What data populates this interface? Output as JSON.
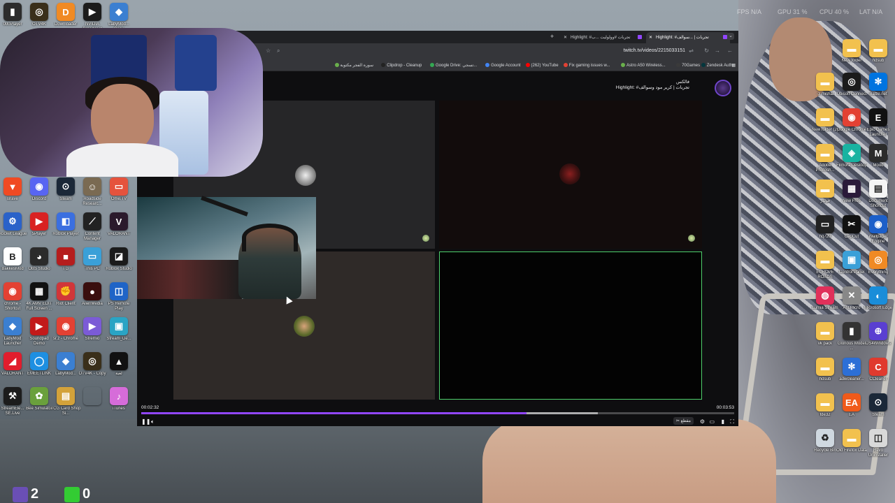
{
  "perf_overlay": {
    "fps": "FPS N/A",
    "gpu": "GPU 31 %",
    "cpu": "CPU 40 %",
    "lat": "LAT N/A"
  },
  "desktop_left": [
    {
      "label": "000Player",
      "icon": "player-icon",
      "color": "#2c2c2c",
      "glyph": "▮"
    },
    {
      "label": "OTV4K",
      "icon": "otv-icon",
      "color": "#3a2f1a",
      "glyph": "◎"
    },
    {
      "label": "Downloader",
      "icon": "downloader-icon",
      "color": "#f08a24",
      "glyph": "D"
    },
    {
      "label": "NVIDIA Broadcast",
      "icon": "nvidia-icon",
      "color": "#1c1c1c",
      "glyph": "▶"
    },
    {
      "label": "LabyMod... Copy",
      "icon": "labymod-icon",
      "color": "#3b7fd1",
      "glyph": "◆"
    },
    {
      "label": "Brave",
      "icon": "brave-icon",
      "color": "#f04a23",
      "glyph": "▼"
    },
    {
      "label": "Discord",
      "icon": "discord-icon",
      "color": "#5865f2",
      "glyph": "◉"
    },
    {
      "label": "Steam",
      "icon": "steam-icon",
      "color": "#1b2838",
      "glyph": "⊙"
    },
    {
      "label": "Roadside Researc...",
      "icon": "roadside-icon",
      "color": "#7a6a52",
      "glyph": "☺"
    },
    {
      "label": "Ome.TV",
      "icon": "ometv-icon",
      "color": "#e5533d",
      "glyph": "▭"
    },
    {
      "label": "Rocket League",
      "icon": "rocket-league-icon",
      "color": "#2a62c9",
      "glyph": "⚙"
    },
    {
      "label": "5Player",
      "icon": "5player-icon",
      "color": "#d92222",
      "glyph": "▶"
    },
    {
      "label": "Roblox Player",
      "icon": "roblox-player-icon",
      "color": "#3b6fe0",
      "glyph": "◧"
    },
    {
      "label": "Content Manager",
      "icon": "content-manager-icon",
      "color": "#222",
      "glyph": "⟋"
    },
    {
      "label": "VALORANT",
      "icon": "valorant-icon",
      "color": "#2b1a2c",
      "glyph": "V"
    },
    {
      "label": "BakkesMod",
      "icon": "bakkesmod-icon",
      "color": "#fff",
      "glyph": "B"
    },
    {
      "label": "OBS Studio",
      "icon": "obs-icon",
      "color": "#2b2b2b",
      "glyph": "◕"
    },
    {
      "label": "TG",
      "icon": "tg-icon",
      "color": "#b51d1d",
      "glyph": "■"
    },
    {
      "label": "This PC",
      "icon": "this-pc-icon",
      "color": "#3aa0d8",
      "glyph": "▭"
    },
    {
      "label": "Roblox Studio",
      "icon": "roblox-studio-icon",
      "color": "#1b1b1b",
      "glyph": "◪"
    },
    {
      "label": "chrome - Shortcut",
      "icon": "chrome-icon",
      "color": "#e34133",
      "glyph": "◉"
    },
    {
      "label": "4K AMV EDIT Full Screen ...",
      "icon": "amv-icon",
      "color": "#111",
      "glyph": "▦"
    },
    {
      "label": "Riot Client",
      "icon": "riot-icon",
      "color": "#d13639",
      "glyph": "✊"
    },
    {
      "label": "AlienMedia",
      "icon": "alienmedia-icon",
      "color": "#3a0e0e",
      "glyph": "●"
    },
    {
      "label": "PS Remote Play",
      "icon": "ps-remote-icon",
      "color": "#1f64c7",
      "glyph": "◫"
    },
    {
      "label": "LabyMod Launcher",
      "icon": "labymod-launcher-icon",
      "color": "#3b7fd1",
      "glyph": "◆"
    },
    {
      "label": "Soundpad Demo",
      "icon": "soundpad-icon",
      "color": "#c21a1a",
      "glyph": "▶"
    },
    {
      "label": "sr.z - Chrome",
      "icon": "chrome-profile-icon",
      "color": "#e34133",
      "glyph": "◉"
    },
    {
      "label": "Stremio",
      "icon": "stremio-icon",
      "color": "#7b5bd6",
      "glyph": "▶"
    },
    {
      "label": "Stream_De...",
      "icon": "stream-deck-icon",
      "color": "#2aa4c4",
      "glyph": "▣"
    },
    {
      "label": "VALORANT",
      "icon": "valorant-icon",
      "color": "#e11d2d",
      "glyph": "◢"
    },
    {
      "label": "EMEETLINK",
      "icon": "emeetlink-icon",
      "color": "#1e8fe1",
      "glyph": "◯"
    },
    {
      "label": "LabyMod...",
      "icon": "labymod-icon",
      "color": "#3b7fd1",
      "glyph": "◆"
    },
    {
      "label": "OTV4K - Copy",
      "icon": "otv-icon",
      "color": "#3a2f1a",
      "glyph": "◎"
    },
    {
      "label": "لعبة",
      "icon": "arabic-app-icon",
      "color": "#111",
      "glyph": "▲"
    },
    {
      "label": "StreamEle... SE.Live",
      "icon": "streamelements-icon",
      "color": "#1c1c1c",
      "glyph": "⚒"
    },
    {
      "label": "Bee Simulator",
      "icon": "bee-simulator-icon",
      "color": "#6aa03c",
      "glyph": "✿"
    },
    {
      "label": "TCG Card Shop Si...",
      "icon": "tcg-icon",
      "color": "#d3a23a",
      "glyph": "▤"
    },
    {
      "label": "",
      "icon": "blank-icon",
      "color": "transparent",
      "glyph": ""
    },
    {
      "label": "iTunes",
      "icon": "itunes-icon",
      "color": "#d66cd9",
      "glyph": "♪"
    }
  ],
  "desktop_right": [
    {
      "label": "New folder",
      "icon": "folder-icon",
      "color": "#f2c14e",
      "glyph": "▬"
    },
    {
      "label": "hdsub",
      "icon": "folder-icon",
      "color": "#f2c14e",
      "glyph": "▬"
    },
    {
      "label": "-3 mishal",
      "icon": "folder-icon",
      "color": "#f2c14e",
      "glyph": "▬"
    },
    {
      "label": "Ubisoft Connect",
      "icon": "ubisoft-icon",
      "color": "#1b1b1b",
      "glyph": "◎"
    },
    {
      "label": "Battle.net",
      "icon": "battlenet-icon",
      "color": "#0074e0",
      "glyph": "✻"
    },
    {
      "label": "New folder (2)",
      "icon": "folder-icon",
      "color": "#f2c14e",
      "glyph": "▬"
    },
    {
      "label": "Google Chrome",
      "icon": "chrome-icon",
      "color": "#e34133",
      "glyph": "◉"
    },
    {
      "label": "Epic Games Launcher",
      "icon": "epic-icon",
      "color": "#111",
      "glyph": "E"
    },
    {
      "label": "Adobe Photosh...",
      "icon": "folder-icon",
      "color": "#f2c14e",
      "glyph": "▬"
    },
    {
      "label": "Filmora Desktop",
      "icon": "filmora-icon",
      "color": "#19b3a1",
      "glyph": "◈"
    },
    {
      "label": "Mood",
      "icon": "mood-icon",
      "color": "#2b2b2b",
      "glyph": "M"
    },
    {
      "label": "فولدر",
      "icon": "folder-icon",
      "color": "#f2c14e",
      "glyph": "▬"
    },
    {
      "label": "New Free",
      "icon": "new-free-icon",
      "color": "#2a1a3a",
      "glyph": "▦"
    },
    {
      "label": "Document Shortcut",
      "icon": "document-icon",
      "color": "#f5f5f5",
      "glyph": "▤"
    },
    {
      "label": "hq720",
      "icon": "hq720-icon",
      "color": "#222",
      "glyph": "▭"
    },
    {
      "label": "CapCut",
      "icon": "capcut-icon",
      "color": "#111",
      "glyph": "✂"
    },
    {
      "label": "Wallpaper Engine",
      "icon": "wallpaper-engine-icon",
      "color": "#1c5fc9",
      "glyph": "◉"
    },
    {
      "label": "EUROPE ROADS",
      "icon": "folder-icon",
      "color": "#f2c14e",
      "glyph": "▬"
    },
    {
      "label": "Control Panel",
      "icon": "control-panel-icon",
      "color": "#3aa0d8",
      "glyph": "▣"
    },
    {
      "label": "Everything",
      "icon": "everything-icon",
      "color": "#f08a24",
      "glyph": "◎"
    },
    {
      "label": "Lumia Stream",
      "icon": "lumia-icon",
      "color": "#e0305a",
      "glyph": "◍"
    },
    {
      "label": "AntiMicro",
      "icon": "antimicro-icon",
      "color": "#888",
      "glyph": "✕"
    },
    {
      "label": "Microsoft Edge",
      "icon": "edge-icon",
      "color": "#1a8dd9",
      "glyph": "◐"
    },
    {
      "label": "vk pack",
      "icon": "folder-icon",
      "color": "#f2c14e",
      "glyph": "▬"
    },
    {
      "label": "Glorious Model ...",
      "icon": "glorious-icon",
      "color": "#333",
      "glyph": "▮"
    },
    {
      "label": "DS4Windows",
      "icon": "ds4windows-icon",
      "color": "#5a3fd1",
      "glyph": "⊕"
    },
    {
      "label": "hdsub",
      "icon": "folder-icon",
      "color": "#f2c14e",
      "glyph": "▬"
    },
    {
      "label": "adwcleaner...",
      "icon": "adwcleaner-icon",
      "color": "#2c6fd6",
      "glyph": "✻"
    },
    {
      "label": "CCleaner",
      "icon": "ccleaner-icon",
      "color": "#e03a2e",
      "glyph": "C"
    },
    {
      "label": "fde32",
      "icon": "folder-icon",
      "color": "#f2c14e",
      "glyph": "▬"
    },
    {
      "label": "EA",
      "icon": "ea-icon",
      "color": "#f05a1a",
      "glyph": "EA"
    },
    {
      "label": "Steam",
      "icon": "steam-icon",
      "color": "#1b2838",
      "glyph": "⊙"
    },
    {
      "label": "Recycle Bin",
      "icon": "recycle-bin-icon",
      "color": "#cfd8e0",
      "glyph": "♻"
    },
    {
      "label": "Old Firefox Data",
      "icon": "folder-icon",
      "color": "#f2c14e",
      "glyph": "▬"
    },
    {
      "label": "Revo Uninstaller",
      "icon": "revo-icon",
      "color": "#d9d9d9",
      "glyph": "◫"
    }
  ],
  "browser": {
    "tabs": [
      {
        "title": "Highlight: #تجربات | ...سوالف"
      },
      {
        "title": "Highlight: #تجربات #وولوليت ...ب"
      }
    ],
    "new_tab": "+",
    "url": "twitch.tv/videos/2215033151",
    "bookmarks": [
      {
        "label": "Zendesk Auth",
        "color": "#03363d"
      },
      {
        "label": "70Games",
        "color": "#3a3a3a"
      },
      {
        "label": "Astro A50 Wireless...",
        "color": "#6ab04c"
      },
      {
        "label": "Fix gaming issues w...",
        "color": "#e34133"
      },
      {
        "label": "(262) YouTube",
        "color": "#ff0000"
      },
      {
        "label": "Google Account",
        "color": "#4285f4"
      },
      {
        "label": "Google Drive: تسجي...",
        "color": "#34a853"
      },
      {
        "label": "Clipdrop - Cleanup",
        "color": "#222"
      },
      {
        "label": "سورة الفجر مكتوبة",
        "color": "#6ab04c"
      }
    ]
  },
  "video": {
    "channel_name": "فالكس",
    "title": "Highlight: #تجربات | كرير مود وسوالف",
    "time_current": "00:02:32",
    "time_total": "00:03:53",
    "progress": 0.65,
    "buffered": 0.77,
    "clip_label": "مقطع"
  },
  "bottom_stats": [
    {
      "value": "2",
      "color": "#6a4fb5",
      "icon": "twitch-followers-icon"
    },
    {
      "value": "0",
      "color": "#33cc33",
      "icon": "kick-icon"
    }
  ]
}
